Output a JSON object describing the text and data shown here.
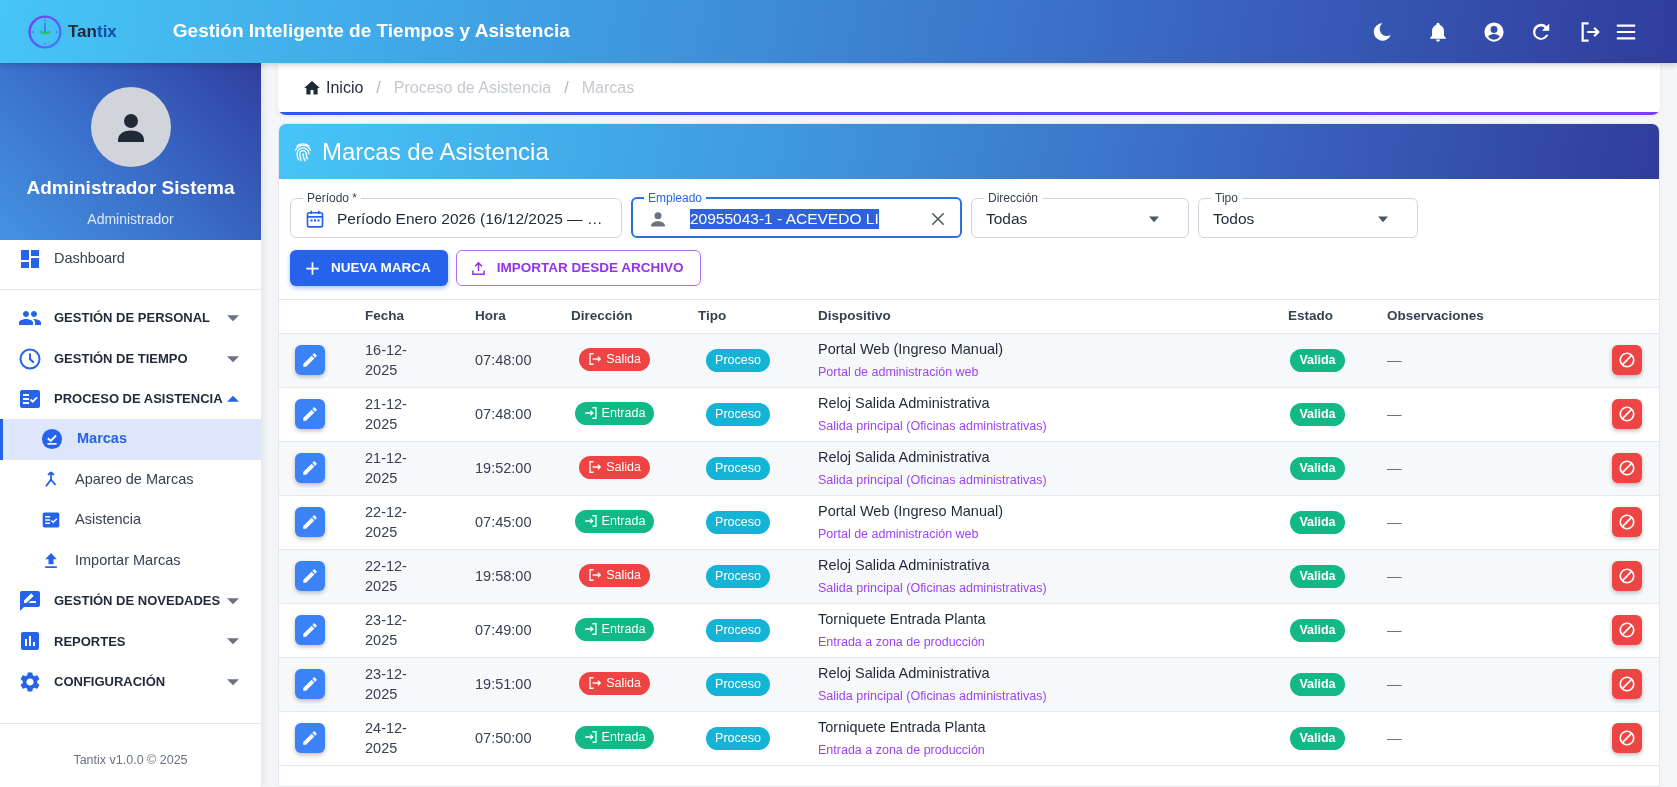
{
  "header": {
    "logo_text": [
      "Tan",
      "tix"
    ],
    "title": "Gestión Inteligente de Tiempos y Asistencia"
  },
  "sidebar": {
    "profile": {
      "name": "Administrador Sistema",
      "role": "Administrador"
    },
    "items": [
      {
        "label": "Dashboard",
        "kind": "link"
      },
      {
        "label": "GESTIÓN DE PERSONAL",
        "kind": "group",
        "expanded": false
      },
      {
        "label": "GESTIÓN DE TIEMPO",
        "kind": "group",
        "expanded": false
      },
      {
        "label": "PROCESO DE ASISTENCIA",
        "kind": "group",
        "expanded": true,
        "children": [
          {
            "label": "Marcas",
            "selected": true
          },
          {
            "label": "Apareo de Marcas",
            "selected": false
          },
          {
            "label": "Asistencia",
            "selected": false
          },
          {
            "label": "Importar Marcas",
            "selected": false
          }
        ]
      },
      {
        "label": "GESTIÓN DE NOVEDADES",
        "kind": "group",
        "expanded": false
      },
      {
        "label": "REPORTES",
        "kind": "group",
        "expanded": false
      },
      {
        "label": "CONFIGURACIÓN",
        "kind": "group",
        "expanded": false
      }
    ],
    "footer": "Tantix v1.0.0 © 2025"
  },
  "breadcrumb": {
    "separator": "/",
    "items": [
      {
        "label": "Inicio",
        "link": true
      },
      {
        "label": "Proceso de Asistencia",
        "link": false
      },
      {
        "label": "Marcas",
        "link": false
      }
    ]
  },
  "page": {
    "title": "Marcas de Asistencia",
    "filters": [
      {
        "label": "Período *",
        "value": "Período Enero 2026 (16/12/2025 — …",
        "kind": "date",
        "focused": false
      },
      {
        "label": "Empleado",
        "value": "20955043-1 - ACEVEDO LI",
        "kind": "autocomplete",
        "focused": true
      },
      {
        "label": "Dirección",
        "value": "Todas",
        "kind": "select",
        "focused": false
      },
      {
        "label": "Tipo",
        "value": "Todos",
        "kind": "select",
        "focused": false
      }
    ],
    "actions": [
      {
        "label": "NUEVA MARCA",
        "kind": "filled"
      },
      {
        "label": "IMPORTAR DESDE ARCHIVO",
        "kind": "outlined"
      }
    ],
    "table": {
      "columns": [
        "Fecha",
        "Hora",
        "Dirección",
        "Tipo",
        "Dispositivo",
        "Estado",
        "Observaciones"
      ],
      "rows": [
        {
          "date": "16-12-2025",
          "time": "07:48:00",
          "direction": {
            "label": "Salida",
            "kind": "exit"
          },
          "type": "Proceso",
          "device": "Portal Web (Ingreso Manual)",
          "location": "Portal de administración web",
          "status": "Valida",
          "notes": "—"
        },
        {
          "date": "21-12-2025",
          "time": "07:48:00",
          "direction": {
            "label": "Entrada",
            "kind": "entry"
          },
          "type": "Proceso",
          "device": "Reloj Salida Administrativa",
          "location": "Salida principal (Oficinas administrativas)",
          "status": "Valida",
          "notes": "—"
        },
        {
          "date": "21-12-2025",
          "time": "19:52:00",
          "direction": {
            "label": "Salida",
            "kind": "exit"
          },
          "type": "Proceso",
          "device": "Reloj Salida Administrativa",
          "location": "Salida principal (Oficinas administrativas)",
          "status": "Valida",
          "notes": "—"
        },
        {
          "date": "22-12-2025",
          "time": "07:45:00",
          "direction": {
            "label": "Entrada",
            "kind": "entry"
          },
          "type": "Proceso",
          "device": "Portal Web (Ingreso Manual)",
          "location": "Portal de administración web",
          "status": "Valida",
          "notes": "—"
        },
        {
          "date": "22-12-2025",
          "time": "19:58:00",
          "direction": {
            "label": "Salida",
            "kind": "exit"
          },
          "type": "Proceso",
          "device": "Reloj Salida Administrativa",
          "location": "Salida principal (Oficinas administrativas)",
          "status": "Valida",
          "notes": "—"
        },
        {
          "date": "23-12-2025",
          "time": "07:49:00",
          "direction": {
            "label": "Entrada",
            "kind": "entry"
          },
          "type": "Proceso",
          "device": "Torniquete Entrada Planta",
          "location": "Entrada a zona de producción",
          "status": "Valida",
          "notes": "—"
        },
        {
          "date": "23-12-2025",
          "time": "19:51:00",
          "direction": {
            "label": "Salida",
            "kind": "exit"
          },
          "type": "Proceso",
          "device": "Reloj Salida Administrativa",
          "location": "Salida principal (Oficinas administrativas)",
          "status": "Valida",
          "notes": "—"
        },
        {
          "date": "24-12-2025",
          "time": "07:50:00",
          "direction": {
            "label": "Entrada",
            "kind": "entry"
          },
          "type": "Proceso",
          "device": "Torniquete Entrada Planta",
          "location": "Entrada a zona de producción",
          "status": "Valida",
          "notes": "—"
        }
      ]
    }
  }
}
